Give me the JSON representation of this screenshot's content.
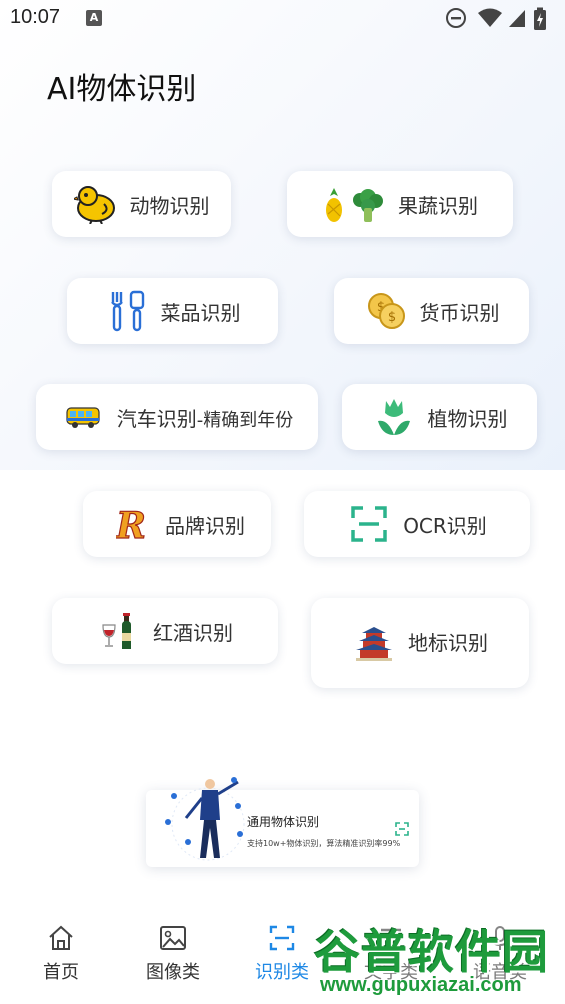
{
  "status": {
    "time": "10:07",
    "a_badge": "A"
  },
  "page_title": "AI物体识别",
  "cards": {
    "animal": "动物识别",
    "fruit": "果蔬识别",
    "dish": "菜品识别",
    "currency": "货币识别",
    "car": "汽车识别",
    "car_sub": "-精确到年份",
    "plant": "植物识别",
    "brand": "品牌识别",
    "ocr": "OCR识别",
    "wine": "红酒识别",
    "landmark": "地标识别"
  },
  "banner": {
    "title": "通用物体识别",
    "desc": "支持10w+物体识别，算法精准识别率99%"
  },
  "nav": {
    "home": "首页",
    "image": "图像类",
    "recognize": "识别类",
    "text": "文字类",
    "voice": "语音类",
    "active_color": "#1e88e5"
  },
  "watermark": {
    "main": "谷普软件园",
    "url": "www.gupuxiazai.com"
  }
}
